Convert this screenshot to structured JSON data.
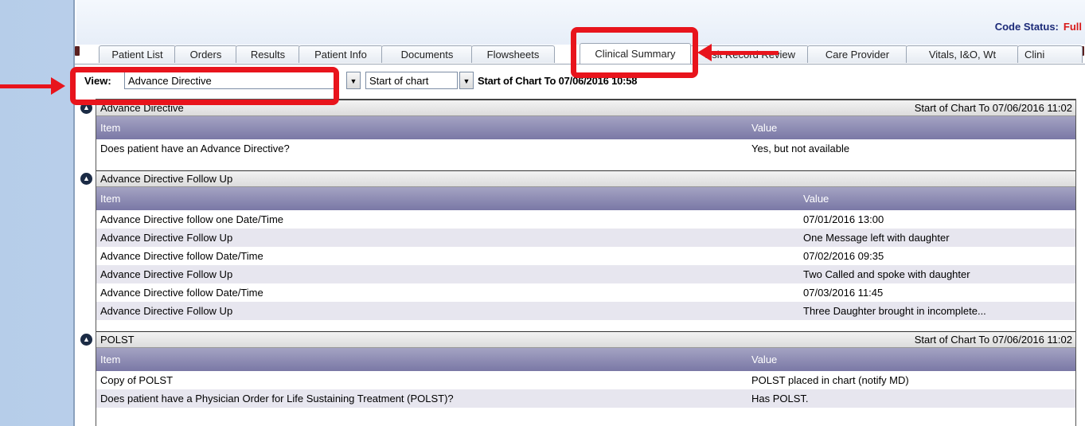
{
  "header": {
    "code_status_label": "Code Status:",
    "code_status_value": "Full"
  },
  "tabs": [
    {
      "label": "Patient List"
    },
    {
      "label": "Orders"
    },
    {
      "label": "Results"
    },
    {
      "label": "Patient Info"
    },
    {
      "label": "Documents"
    },
    {
      "label": "Flowsheets"
    },
    {
      "label": "Clinical Summary",
      "active": true
    },
    {
      "label": "Visit Record Review"
    },
    {
      "label": "Care Provider"
    },
    {
      "label": "Vitals, I&O, Wt"
    },
    {
      "label": "Clini"
    }
  ],
  "view": {
    "label": "View:",
    "selected": "Advance Directive",
    "range_selected": "Start of chart",
    "range_text": "Start of Chart To 07/06/2016 10:58"
  },
  "sections": [
    {
      "title": "Advance Directive",
      "range": "Start of Chart To 07/06/2016 11:02",
      "columns": [
        "Item",
        "Value"
      ],
      "rows": [
        [
          "Does patient have an Advance Directive?",
          "Yes, but not available"
        ]
      ]
    },
    {
      "title": "Advance Directive Follow Up",
      "range": "",
      "columns": [
        "Item",
        "Value"
      ],
      "rows": [
        [
          "Advance Directive follow one Date/Time",
          "07/01/2016 13:00"
        ],
        [
          "Advance Directive Follow Up",
          "One Message left with daughter"
        ],
        [
          "Advance Directive follow Date/Time",
          "07/02/2016 09:35"
        ],
        [
          "Advance Directive Follow Up",
          "Two Called and spoke with daughter"
        ],
        [
          "Advance Directive follow Date/Time",
          "07/03/2016 11:45"
        ],
        [
          "Advance Directive Follow Up",
          "Three Daughter brought in  incomplete..."
        ]
      ]
    },
    {
      "title": "POLST",
      "range": "Start of Chart To 07/06/2016 11:02",
      "columns": [
        "Item",
        "Value"
      ],
      "rows": [
        [
          "Copy of POLST",
          "POLST placed in chart (notify MD)"
        ],
        [
          "Does patient have a Physician Order for Life Sustaining Treatment (POLST)?",
          "Has POLST."
        ]
      ]
    }
  ],
  "icons": {
    "collapse": "chevron-up-circle-icon",
    "dropdown": "dropdown-arrow-icon"
  },
  "colors": {
    "highlight": "#e8141c",
    "column_header": "#8d8bb5",
    "alt_row": "#e7e6ef",
    "code_status_value": "#d81818",
    "code_status_label": "#1b2a78"
  }
}
